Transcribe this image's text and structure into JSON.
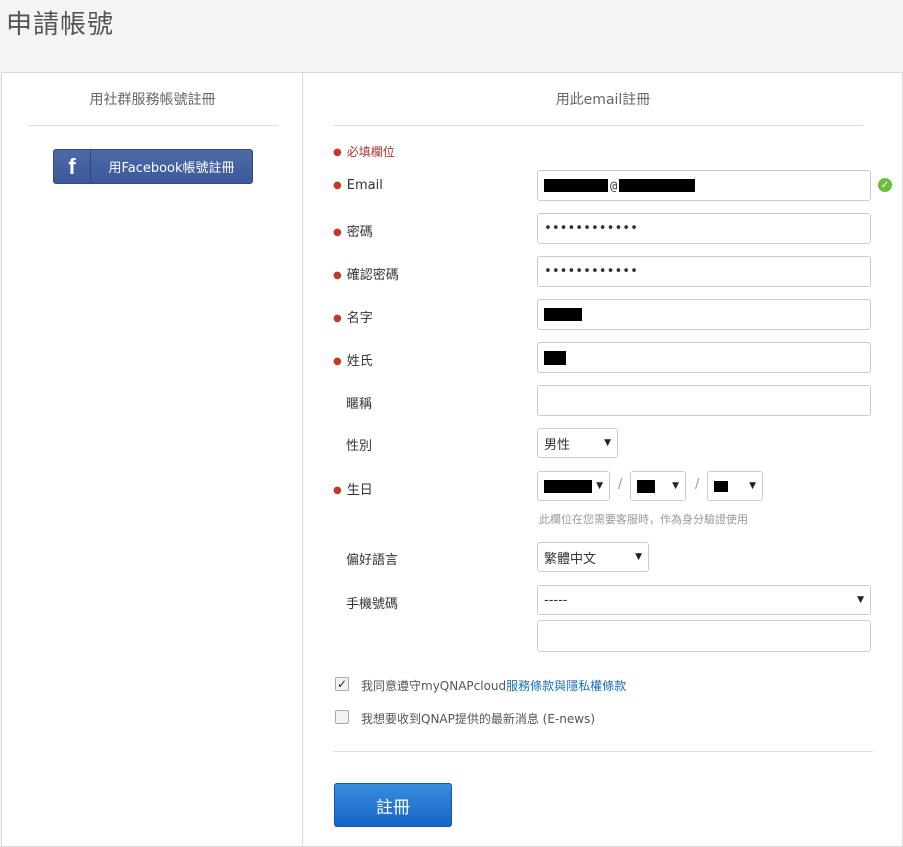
{
  "page": {
    "title": "申請帳號"
  },
  "social": {
    "heading": "用社群服務帳號註冊",
    "facebook_logo": "f",
    "facebook_label": "用Facebook帳號註冊"
  },
  "email_form": {
    "heading": "用此email註冊",
    "required_note": "必填欄位",
    "fields": {
      "email": {
        "label": "Email",
        "value": "@"
      },
      "password": {
        "label": "密碼",
        "value": "••••••••••••"
      },
      "confirm_password": {
        "label": "確認密碼",
        "value": "••••••••••••"
      },
      "first_name": {
        "label": "名字"
      },
      "last_name": {
        "label": "姓氏"
      },
      "nickname": {
        "label": "暱稱",
        "value": ""
      },
      "gender": {
        "label": "性別",
        "value": "男性"
      },
      "birthday": {
        "label": "生日",
        "separator": "/",
        "hint": "此欄位在您需要客服時，作為身分驗證使用"
      },
      "language": {
        "label": "偏好語言",
        "value": "繁體中文"
      },
      "mobile": {
        "label": "手機號碼",
        "country_value": "-----",
        "number_value": ""
      }
    },
    "agreements": {
      "terms_prefix": "我同意遵守myQNAPcloud",
      "terms_link": "服務條款",
      "terms_and": "與",
      "privacy_link": "隱私權條款",
      "terms_checked": true,
      "enews_label": "我想要收到QNAP提供的最新消息 (E-news)",
      "enews_checked": false
    },
    "submit_label": "註冊"
  },
  "icons": {
    "required": "●",
    "check": "✓",
    "caret": "▼"
  },
  "colors": {
    "facebook": "#3b5998",
    "submit": "#1563c4",
    "required": "#c0392b",
    "valid": "#6cbf3b",
    "link": "#1a6fb5"
  }
}
